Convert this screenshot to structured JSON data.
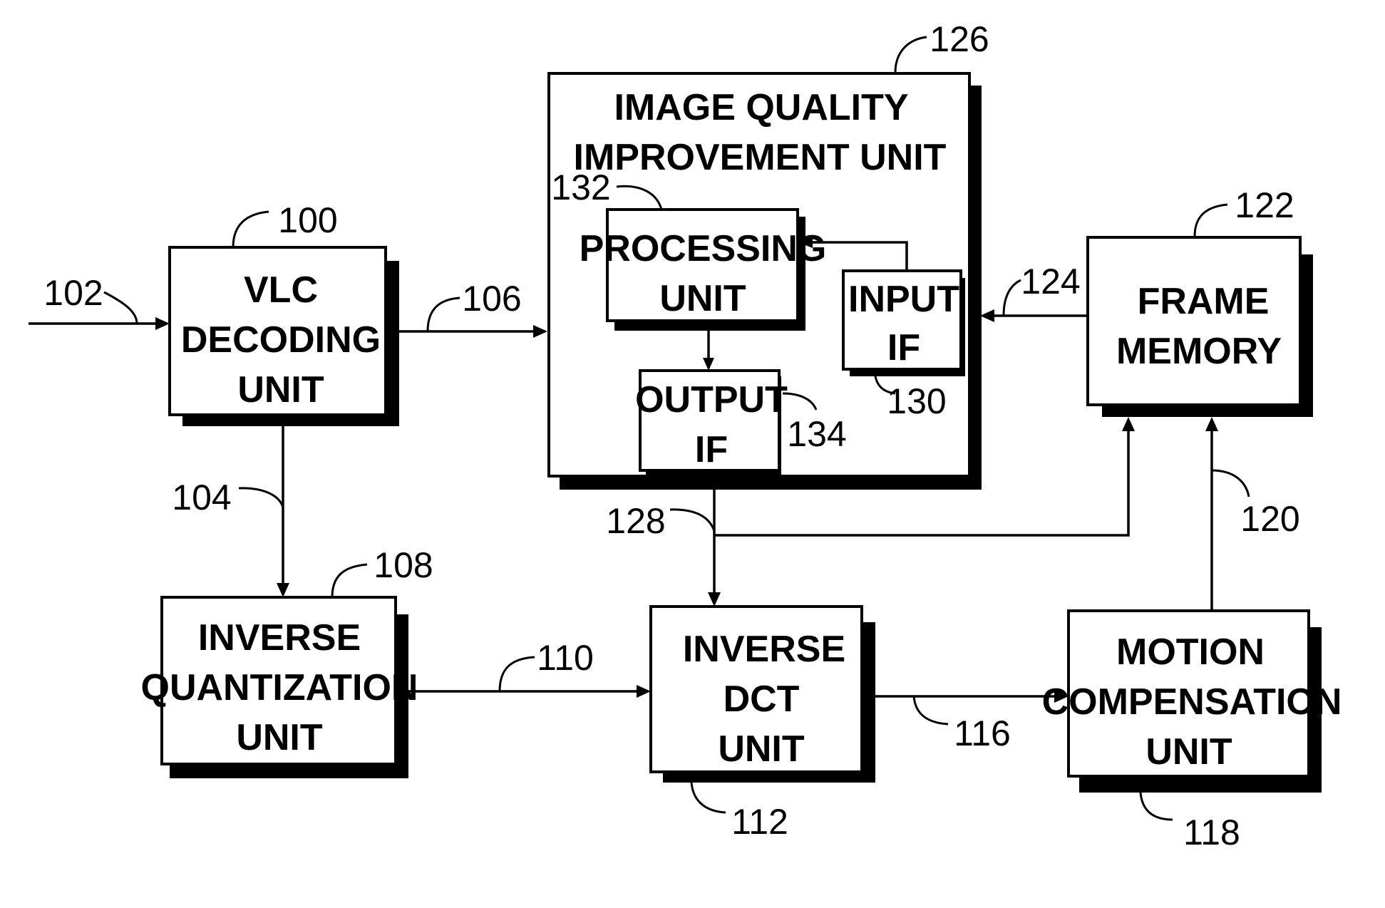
{
  "diagram": {
    "type": "block-diagram",
    "blocks": {
      "vlc": {
        "ref": "100",
        "lines": [
          "VLC",
          "DECODING",
          "UNIT"
        ]
      },
      "iq_improve": {
        "ref": "126",
        "lines": [
          "IMAGE QUALITY",
          "IMPROVEMENT UNIT"
        ]
      },
      "processing": {
        "ref": "132",
        "lines": [
          "PROCESSING",
          "UNIT"
        ]
      },
      "input_if": {
        "ref": "130",
        "lines": [
          "INPUT",
          "IF"
        ]
      },
      "output_if": {
        "ref": "134",
        "lines": [
          "OUTPUT",
          "IF"
        ]
      },
      "frame_memory": {
        "ref": "122",
        "lines": [
          "FRAME",
          "MEMORY"
        ]
      },
      "inv_quant": {
        "ref": "108",
        "lines": [
          "INVERSE",
          "QUANTIZATION",
          "UNIT"
        ]
      },
      "inv_dct": {
        "ref": "112",
        "lines": [
          "INVERSE",
          "DCT",
          "UNIT"
        ]
      },
      "motion_comp": {
        "ref": "118",
        "lines": [
          "MOTION",
          "COMPENSATION",
          "UNIT"
        ]
      }
    },
    "signals": {
      "input": "102",
      "vlc_to_iq": "106",
      "vlc_to_invquant": "104",
      "invquant_to_invdct": "110",
      "invdct_to_mc": "116",
      "mc_to_fm": "120",
      "fm_to_inputif": "124",
      "outputif_out": "128"
    },
    "edges": [
      {
        "from": "input",
        "to": "vlc",
        "ref": "102"
      },
      {
        "from": "vlc",
        "to": "iq_improve",
        "ref": "106"
      },
      {
        "from": "vlc",
        "to": "inv_quant",
        "ref": "104"
      },
      {
        "from": "inv_quant",
        "to": "inv_dct",
        "ref": "110"
      },
      {
        "from": "inv_dct",
        "to": "motion_comp",
        "ref": "116"
      },
      {
        "from": "motion_comp",
        "to": "frame_memory",
        "ref": "120"
      },
      {
        "from": "frame_memory",
        "to": "input_if",
        "ref": "124"
      },
      {
        "from": "input_if",
        "to": "processing",
        "ref": ""
      },
      {
        "from": "processing",
        "to": "output_if",
        "ref": ""
      },
      {
        "from": "output_if",
        "to": "inv_dct",
        "ref": "128"
      },
      {
        "from": "output_if",
        "to": "frame_memory",
        "ref": "128"
      }
    ]
  }
}
